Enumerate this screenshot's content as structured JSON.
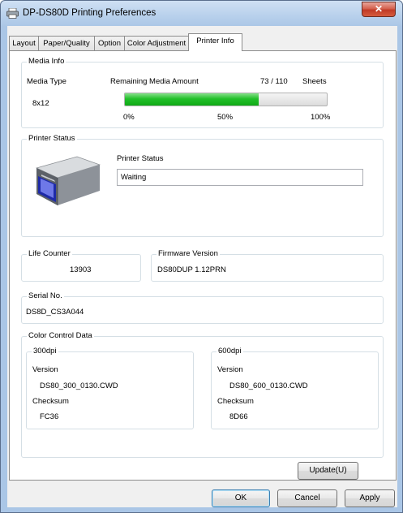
{
  "window": {
    "title": "DP-DS80D Printing Preferences",
    "close_glyph": "✕"
  },
  "tabs": [
    {
      "label": "Layout",
      "active": false
    },
    {
      "label": "Paper/Quality",
      "active": false
    },
    {
      "label": "Option",
      "active": false
    },
    {
      "label": "Color Adjustment",
      "active": false
    },
    {
      "label": "Printer Info",
      "active": true
    }
  ],
  "media_info": {
    "group_label": "Media Info",
    "media_type_label": "Media Type",
    "media_type_value": "8x12",
    "remaining_label": "Remaining Media Amount",
    "remaining_value": "73 / 110",
    "remaining_unit": "Sheets",
    "progress_fraction": 0.664,
    "scale": [
      "0%",
      "50%",
      "100%"
    ],
    "bar_color": "#22c02a"
  },
  "printer_status": {
    "group_label": "Printer Status",
    "status_label": "Printer Status",
    "status_value": "Waiting"
  },
  "life_counter": {
    "group_label": "Life Counter",
    "value": "13903"
  },
  "firmware": {
    "group_label": "Firmware Version",
    "value": "DS80DUP 1.12PRN"
  },
  "serial": {
    "group_label": "Serial No.",
    "value": "DS8D_CS3A044"
  },
  "color_control": {
    "group_label": "Color Control Data",
    "dpi300": {
      "label": "300dpi",
      "version_label": "Version",
      "version_value": "DS80_300_0130.CWD",
      "checksum_label": "Checksum",
      "checksum_value": "FC36"
    },
    "dpi600": {
      "label": "600dpi",
      "version_label": "Version",
      "version_value": "DS80_600_0130.CWD",
      "checksum_label": "Checksum",
      "checksum_value": "8D66"
    }
  },
  "buttons": {
    "update": "Update(U)",
    "ok": "OK",
    "cancel": "Cancel",
    "apply": "Apply"
  },
  "icons": {
    "title": "printer-icon",
    "printer_image": "printer-device-image"
  }
}
